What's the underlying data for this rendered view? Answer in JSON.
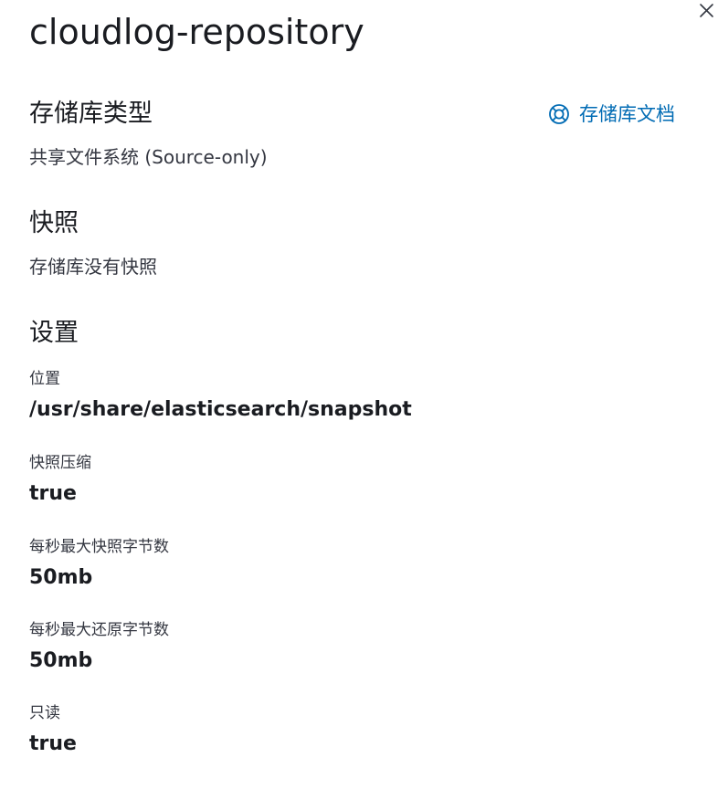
{
  "flyout": {
    "title": "cloudlog-repository",
    "close_icon": "close-icon"
  },
  "repository_type": {
    "heading": "存储库类型",
    "value": "共享文件系统 (Source-only)",
    "doc_link": {
      "label": "存储库文档",
      "icon": "help-lifebuoy-icon",
      "color": "#006bb4"
    }
  },
  "snapshots": {
    "heading": "快照",
    "empty_text": "存储库没有快照"
  },
  "settings": {
    "heading": "设置",
    "items": [
      {
        "label": "位置",
        "value": "/usr/share/elasticsearch/snapshot"
      },
      {
        "label": "快照压缩",
        "value": "true"
      },
      {
        "label": "每秒最大快照字节数",
        "value": "50mb"
      },
      {
        "label": "每秒最大还原字节数",
        "value": "50mb"
      },
      {
        "label": "只读",
        "value": "true"
      }
    ]
  }
}
